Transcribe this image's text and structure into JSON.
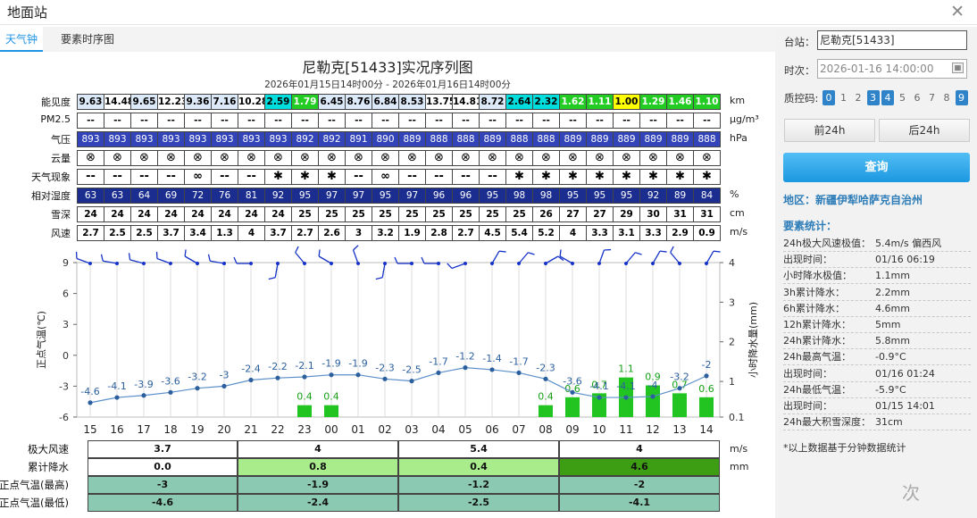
{
  "window": {
    "title": "地面站",
    "close_icon": "close-icon"
  },
  "tabs": [
    "天气钟",
    "要素时序图"
  ],
  "chart": {
    "title": "尼勒克[51433]实况序列图",
    "subtitle": "2026年01月15日14时00分 - 2026年01月16日14时00分"
  },
  "hours": [
    "15",
    "16",
    "17",
    "18",
    "19",
    "20",
    "21",
    "22",
    "23",
    "00",
    "01",
    "02",
    "03",
    "04",
    "05",
    "06",
    "07",
    "08",
    "09",
    "10",
    "11",
    "12",
    "13",
    "14"
  ],
  "table_rows": [
    {
      "label": "能见度",
      "unit": "km",
      "values": [
        "9.63",
        "14.48",
        "9.65",
        "12.23",
        "9.36",
        "7.16",
        "10.28",
        "2.59",
        "1.79",
        "6.45",
        "8.76",
        "6.84",
        "8.53",
        "13.75",
        "14.81",
        "8.72",
        "2.64",
        "2.32",
        "1.62",
        "1.11",
        "1.00",
        "1.29",
        "1.46",
        "1.10"
      ]
    },
    {
      "label": "PM2.5",
      "unit": "μg/m³",
      "values": [
        "--",
        "--",
        "--",
        "--",
        "--",
        "--",
        "--",
        "--",
        "--",
        "--",
        "--",
        "--",
        "--",
        "--",
        "--",
        "--",
        "--",
        "--",
        "--",
        "--",
        "--",
        "--",
        "--",
        "--"
      ]
    },
    {
      "label": "气压",
      "unit": "hPa",
      "values": [
        "893",
        "893",
        "893",
        "893",
        "893",
        "893",
        "893",
        "893",
        "892",
        "892",
        "891",
        "890",
        "889",
        "888",
        "888",
        "889",
        "888",
        "888",
        "889",
        "889",
        "889",
        "889",
        "889",
        "888"
      ]
    },
    {
      "label": "云量",
      "unit": "",
      "values": [
        "⊗",
        "⊗",
        "⊗",
        "⊗",
        "⊗",
        "⊗",
        "⊗",
        "⊗",
        "⊗",
        "⊗",
        "⊗",
        "⊗",
        "⊗",
        "⊗",
        "⊗",
        "⊗",
        "⊗",
        "⊗",
        "⊗",
        "⊗",
        "⊗",
        "⊗",
        "⊗",
        "⊗"
      ]
    },
    {
      "label": "天气现象",
      "unit": "",
      "values": [
        "--",
        "--",
        "--",
        "--",
        "∞",
        "--",
        "--",
        "✱",
        "✱",
        "✱",
        "--",
        "∞",
        "--",
        "--",
        "--",
        "--",
        "✱",
        "✱",
        "✱",
        "✱",
        "✱",
        "✱",
        "✱",
        "✱"
      ]
    },
    {
      "label": "相对湿度",
      "unit": "%",
      "values": [
        "63",
        "63",
        "64",
        "69",
        "72",
        "76",
        "81",
        "92",
        "95",
        "97",
        "97",
        "95",
        "97",
        "96",
        "96",
        "95",
        "98",
        "98",
        "95",
        "95",
        "95",
        "92",
        "89",
        "84"
      ]
    },
    {
      "label": "雪深",
      "unit": "cm",
      "values": [
        "24",
        "24",
        "24",
        "24",
        "24",
        "24",
        "24",
        "24",
        "25",
        "25",
        "25",
        "25",
        "25",
        "25",
        "25",
        "25",
        "25",
        "26",
        "27",
        "27",
        "29",
        "30",
        "31",
        "31"
      ]
    },
    {
      "label": "风速",
      "unit": "m/s",
      "values": [
        "2.7",
        "2.5",
        "2.5",
        "3.7",
        "3.4",
        "1.3",
        "4",
        "3.7",
        "2.7",
        "2.6",
        "3",
        "3.2",
        "1.9",
        "2.8",
        "2.7",
        "4.5",
        "5.4",
        "5.2",
        "4",
        "3.3",
        "3.1",
        "3.3",
        "2.9",
        "0.9"
      ]
    }
  ],
  "colors": {
    "accent": "#1f95e6",
    "temp_line": "#5b8fc9",
    "precip": "#22c422",
    "pressure_bg": "#3344b8",
    "humidity_bg": "#1b2e8f"
  },
  "chart_data": {
    "type": "line",
    "x": [
      "15",
      "16",
      "17",
      "18",
      "19",
      "20",
      "21",
      "22",
      "23",
      "00",
      "01",
      "02",
      "03",
      "04",
      "05",
      "06",
      "07",
      "08",
      "09",
      "10",
      "11",
      "12",
      "13",
      "14"
    ],
    "series": [
      {
        "name": "正点气温(℃)",
        "values": [
          -4.6,
          -4.1,
          -3.9,
          -3.6,
          -3.2,
          -3,
          -2.4,
          -2.2,
          -2.1,
          -1.9,
          -1.9,
          -2.3,
          -2.5,
          -1.7,
          -1.2,
          -1.4,
          -1.7,
          -2.3,
          -3.6,
          -4.1,
          -4.1,
          -4,
          -3.2,
          -2
        ]
      },
      {
        "name": "小时降水量(mm)",
        "type": "bar",
        "values": [
          null,
          null,
          null,
          null,
          null,
          null,
          null,
          null,
          0.4,
          0.4,
          null,
          null,
          null,
          null,
          null,
          null,
          null,
          0.4,
          0.6,
          0.7,
          1.1,
          0.9,
          0.7,
          0.6
        ]
      }
    ],
    "wind_dir_deg": [
      290,
      280,
      285,
      290,
      300,
      280,
      270,
      190,
      320,
      300,
      340,
      190,
      270,
      270,
      250,
      30,
      40,
      60,
      300,
      20,
      40,
      30,
      320,
      30
    ],
    "ylabel_left": "正点气温(℃)",
    "ylabel_right": "小时降水量(mm)",
    "ylim_left": [
      -6,
      9
    ],
    "yticks_left": [
      9,
      6,
      3,
      0,
      -3,
      -6
    ],
    "ylim_right": [
      0.1,
      4
    ],
    "yticks_right": [
      4,
      3,
      2,
      1,
      0.1
    ]
  },
  "summary": {
    "unit_col": [
      "m/s",
      "mm"
    ],
    "rows": [
      {
        "label": "极大风速",
        "values": [
          "3.7",
          "4",
          "5.4",
          "4"
        ]
      },
      {
        "label": "累计降水",
        "values": [
          "0.0",
          "0.8",
          "0.4",
          "4.6"
        ]
      },
      {
        "label": "正点气温(最高)",
        "values": [
          "-3",
          "-1.9",
          "-1.2",
          "-2"
        ]
      },
      {
        "label": "正点气温(最低)",
        "values": [
          "-4.6",
          "-2.4",
          "-2.5",
          "-4.1"
        ]
      }
    ]
  },
  "side": {
    "station_label": "台站：",
    "station_value": "尼勒克[51433]",
    "time_label": "时次：",
    "time_value": "2026-01-16 14:00:00",
    "qc_label": "质控码:",
    "qc_codes": [
      "0",
      "1",
      "2",
      "3",
      "4",
      "5",
      "6",
      "7",
      "8",
      "9"
    ],
    "qc_selected": [
      "0",
      "3",
      "4",
      "9"
    ],
    "prev_btn": "前24h",
    "next_btn": "后24h",
    "query_btn": "查询",
    "region": "地区：新疆伊犁哈萨克自治州",
    "stats_title": "要素统计：",
    "stats": [
      {
        "k": "24h极大风速极值：",
        "v": "5.4m/s 偏西风"
      },
      {
        "k": "出现时间：",
        "v": "01/16 06:19"
      },
      {
        "k": "小时降水极值：",
        "v": "1.1mm"
      },
      {
        "k": "3h累计降水：",
        "v": "2.2mm"
      },
      {
        "k": "6h累计降水：",
        "v": "4.6mm"
      },
      {
        "k": "12h累计降水：",
        "v": "5mm"
      },
      {
        "k": "24h累计降水：",
        "v": "5.8mm"
      },
      {
        "k": "24h最高气温：",
        "v": "-0.9°C"
      },
      {
        "k": "出现时间：",
        "v": "01/16 01:24"
      },
      {
        "k": "24h最低气温：",
        "v": "-5.9°C"
      },
      {
        "k": "出现时间：",
        "v": "01/15 14:01"
      },
      {
        "k": "24h最大积雪深度：",
        "v": "31cm"
      }
    ],
    "note": "*以上数据基于分钟数据统计"
  },
  "watermark": "次"
}
